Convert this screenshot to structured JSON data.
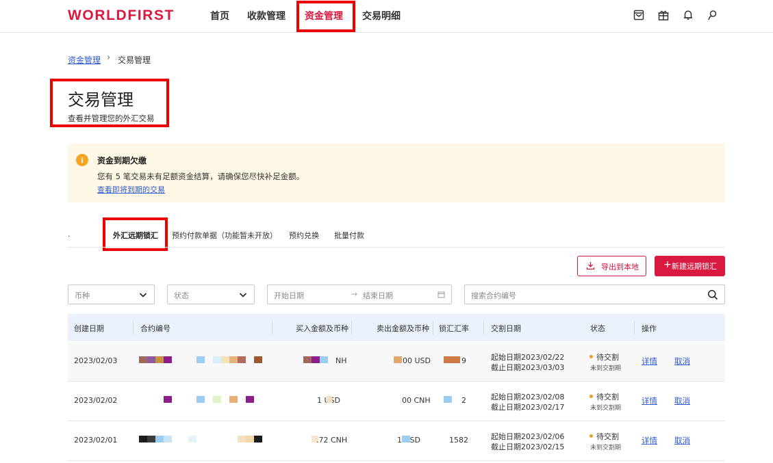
{
  "header": {
    "logo": "WORLDFIRST",
    "nav": [
      "首页",
      "收款管理",
      "资金管理",
      "交易明细"
    ],
    "active_index": 2,
    "brand_color": "#d9193f",
    "icons": [
      "inbox-icon",
      "gift-icon",
      "bell-icon",
      "user-icon"
    ]
  },
  "breadcrumb": {
    "parent": "资金管理",
    "current": "交易管理"
  },
  "page": {
    "title": "交易管理",
    "subtitle": "查看并管理您的外汇交易"
  },
  "alert": {
    "title": "资金到期欠缴",
    "body": "您有 5 笔交易未有足额资金结算，请确保您尽快补足金额。",
    "link": "查看即将到期的交易"
  },
  "tabs": [
    ".",
    "外汇远期锁汇",
    "预约付款单据（功能暂未开放）",
    "预约兑换",
    "批量付款"
  ],
  "active_tab": 1,
  "actions": {
    "export": "导出到本地",
    "new": "新建远期锁汇"
  },
  "filters": {
    "currency_placeholder": "币种",
    "status_placeholder": "状态",
    "start_date": "开始日期",
    "end_date": "结束日期",
    "search_placeholder": "搜索合约编号"
  },
  "table": {
    "columns": [
      "创建日期",
      "合约编号",
      "买入金额及币种",
      "卖出金额及币种",
      "锁汇汇率",
      "交割日期",
      "状态",
      "操作"
    ],
    "rows": [
      {
        "created": "2023/02/03",
        "buy": "NH",
        "sell": "00 USD",
        "rate": "9",
        "start": "起始日期2023/02/22",
        "end": "截止日期2023/03/03",
        "status": "待交割",
        "status_sub": "未到交割期",
        "detail": "详情",
        "cancel": "取消"
      },
      {
        "created": "2023/02/02",
        "buy": "1  USD",
        "sell": "00 CNH",
        "rate": "2",
        "start": "起始日期2023/02/08",
        "end": "截止日期2023/02/17",
        "status": "待交割",
        "status_sub": "未到交割期",
        "detail": "详情",
        "cancel": "取消"
      },
      {
        "created": "2023/02/01",
        "buy": ".72 CNH",
        "sell": "1  USD",
        "rate": "1582",
        "start": "起始日期2023/02/06",
        "end": "截止日期2023/02/15",
        "status": "待交割",
        "status_sub": "未到交割期",
        "detail": "详情",
        "cancel": "取消"
      }
    ]
  },
  "colors": {
    "accent": "#d9193f",
    "link": "#2d5bd2",
    "alert_bg": "#fff8e6",
    "header_bg": "#ebf1fa",
    "status": "#f59a23"
  }
}
